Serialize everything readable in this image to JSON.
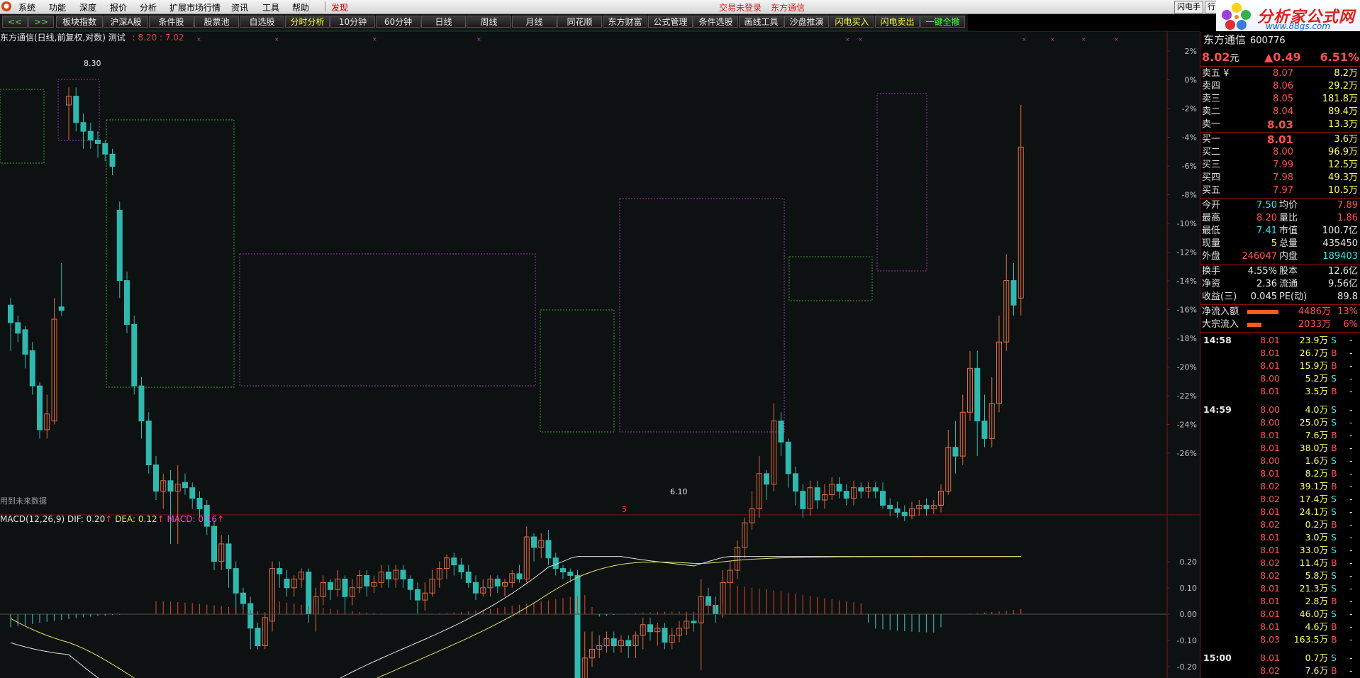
{
  "menu": {
    "items": [
      "系统",
      "功能",
      "深度",
      "报价",
      "分析",
      "扩展市场行情",
      "资讯",
      "工具",
      "帮助"
    ],
    "discover": "发现",
    "trade_status": "交易未登录",
    "stock_name": "东方通信",
    "flash_btn": "闪电手",
    "row_btn": "行"
  },
  "brand": {
    "title": "分析家公式网",
    "url": "www.88gs.com"
  },
  "toolbar": {
    "nav": [
      "<<",
      ">>"
    ],
    "buttons": [
      "板块指数",
      "沪深A股",
      "条件股",
      "股票池",
      "自选股",
      "分时分析",
      "10分钟",
      "60分钟",
      "日线",
      "周线",
      "月线",
      "同花顺",
      "东方财富",
      "公式管理",
      "条件选股",
      "画线工具",
      "沙盘推演",
      "闪电买入",
      "闪电卖出",
      "一键全撤"
    ]
  },
  "chart": {
    "header": "东方通信(日线,前复权,对数) 测试",
    "header_values": ": 8.20 : 7.02",
    "high_label": "8.30",
    "low_label": "6.10",
    "future_note": "用到未来数据",
    "marker": "5",
    "y_axis": [
      "2%",
      "0%",
      "-2%",
      "-4%",
      "-6%",
      "-8%",
      "-10%",
      "-12%",
      "-14%",
      "-16%",
      "-18%",
      "-20%",
      "-22%",
      "-24%",
      "-26%"
    ],
    "colors": {
      "up": "#e06a3c",
      "down": "#2fb8b0",
      "box_green": "#2aa02a",
      "box_magenta": "#a030b0"
    }
  },
  "macd": {
    "name": "MACD(12,26,9)",
    "dif": "DIF: 0.20",
    "dea": "DEA: 0.12",
    "macd": "MACD: 0.16",
    "arrow": "↑",
    "y_axis": [
      "0.20",
      "0.10",
      "0.00",
      "-0.10",
      "-0.20"
    ]
  },
  "panel": {
    "name": "东方通信",
    "code": "600776",
    "price": "8.02",
    "unit": "元",
    "change": "▲0.49",
    "pct": "6.51%",
    "sell": [
      {
        "label": "卖五 ¥",
        "price": "8.07",
        "vol": "8.2万"
      },
      {
        "label": "卖四",
        "price": "8.06",
        "vol": "29.2万"
      },
      {
        "label": "卖三",
        "price": "8.05",
        "vol": "181.8万"
      },
      {
        "label": "卖二",
        "price": "8.04",
        "vol": "89.4万"
      },
      {
        "label": "卖一",
        "price": "8.03",
        "vol": "13.3万"
      }
    ],
    "buy": [
      {
        "label": "买一",
        "price": "8.01",
        "vol": "3.6万"
      },
      {
        "label": "买二",
        "price": "8.00",
        "vol": "96.9万"
      },
      {
        "label": "买三",
        "price": "7.99",
        "vol": "12.5万"
      },
      {
        "label": "买四",
        "price": "7.98",
        "vol": "49.3万"
      },
      {
        "label": "买五",
        "price": "7.97",
        "vol": "10.5万"
      }
    ],
    "stats": [
      {
        "l1": "今开",
        "v1": "7.50",
        "l2": "均价",
        "v2": "7.89"
      },
      {
        "l1": "最高",
        "v1": "8.20",
        "l2": "量比",
        "v2": "1.86"
      },
      {
        "l1": "最低",
        "v1": "7.41",
        "l2": "市值",
        "v2": "100.7亿"
      },
      {
        "l1": "现量",
        "v1": "5",
        "l2": "总量",
        "v2": "435450"
      },
      {
        "l1": "外盘",
        "v1": "246047",
        "l2": "内盘",
        "v2": "189403"
      }
    ],
    "stats2": [
      {
        "l1": "换手",
        "v1": "4.55%",
        "l2": "股本",
        "v2": "12.6亿"
      },
      {
        "l1": "净资",
        "v1": "2.36",
        "l2": "流通",
        "v2": "9.56亿"
      },
      {
        "l1": "收益(三)",
        "v1": "0.045",
        "l2": "PE(动)",
        "v2": "89.8"
      }
    ],
    "flow": [
      {
        "label": "净流入额",
        "value": "4486万",
        "pct": "13%"
      },
      {
        "label": "大宗流入",
        "value": "2033万",
        "pct": "6%"
      }
    ],
    "ticks": [
      {
        "t": "14:58",
        "p": "8.01",
        "v": "23.9万",
        "bs": "S",
        "m": "-"
      },
      {
        "t": "",
        "p": "8.01",
        "v": "26.7万",
        "bs": "B",
        "m": "-"
      },
      {
        "t": "",
        "p": "8.01",
        "v": "15.9万",
        "bs": "B",
        "m": "-"
      },
      {
        "t": "",
        "p": "8.00",
        "v": "5.2万",
        "bs": "S",
        "m": "-"
      },
      {
        "t": "",
        "p": "8.01",
        "v": "3.5万",
        "bs": "B",
        "m": "-"
      },
      {
        "t": "14:59",
        "p": "8.00",
        "v": "4.0万",
        "bs": "S",
        "m": "-"
      },
      {
        "t": "",
        "p": "8.00",
        "v": "25.0万",
        "bs": "S",
        "m": "-"
      },
      {
        "t": "",
        "p": "8.01",
        "v": "7.6万",
        "bs": "B",
        "m": "-"
      },
      {
        "t": "",
        "p": "8.01",
        "v": "38.0万",
        "bs": "B",
        "m": "-"
      },
      {
        "t": "",
        "p": "8.00",
        "v": "1.6万",
        "bs": "S",
        "m": "-"
      },
      {
        "t": "",
        "p": "8.01",
        "v": "8.2万",
        "bs": "B",
        "m": "-"
      },
      {
        "t": "",
        "p": "8.02",
        "v": "39.1万",
        "bs": "B",
        "m": "-"
      },
      {
        "t": "",
        "p": "8.02",
        "v": "17.4万",
        "bs": "S",
        "m": "-"
      },
      {
        "t": "",
        "p": "8.01",
        "v": "24.1万",
        "bs": "S",
        "m": "-"
      },
      {
        "t": "",
        "p": "8.02",
        "v": "0.2万",
        "bs": "B",
        "m": "-"
      },
      {
        "t": "",
        "p": "8.01",
        "v": "3.0万",
        "bs": "S",
        "m": "-"
      },
      {
        "t": "",
        "p": "8.01",
        "v": "33.0万",
        "bs": "S",
        "m": "-"
      },
      {
        "t": "",
        "p": "8.02",
        "v": "11.4万",
        "bs": "B",
        "m": "-"
      },
      {
        "t": "",
        "p": "8.02",
        "v": "5.8万",
        "bs": "S",
        "m": "-"
      },
      {
        "t": "",
        "p": "8.01",
        "v": "21.3万",
        "bs": "S",
        "m": "-"
      },
      {
        "t": "",
        "p": "8.01",
        "v": "2.8万",
        "bs": "B",
        "m": "-"
      },
      {
        "t": "",
        "p": "8.01",
        "v": "46.0万",
        "bs": "S",
        "m": "-"
      },
      {
        "t": "",
        "p": "8.01",
        "v": "4.6万",
        "bs": "B",
        "m": "-"
      },
      {
        "t": "",
        "p": "8.03",
        "v": "163.5万",
        "bs": "B",
        "m": "-"
      },
      {
        "t": "15:00",
        "p": "8.01",
        "v": "0.7万",
        "bs": "S",
        "m": "-"
      },
      {
        "t": "",
        "p": "8.02",
        "v": "7.6万",
        "bs": "B",
        "m": "-"
      }
    ]
  }
}
